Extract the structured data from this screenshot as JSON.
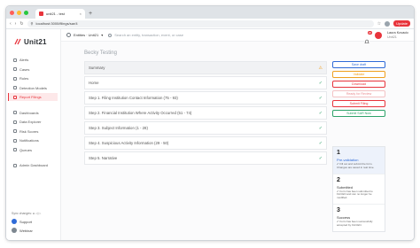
{
  "browser": {
    "tab_title": "unit21 - test",
    "tab_close": "×",
    "new_tab": "+",
    "url": "localhost:3000/filings/sar/4",
    "update_label": "Update"
  },
  "brand": {
    "logo_text": "Unit21",
    "accent": "#e8343c"
  },
  "sidebar": {
    "items": [
      {
        "label": "Alerts"
      },
      {
        "label": "Cases"
      },
      {
        "label": "Rules"
      },
      {
        "label": "Detection Models"
      },
      {
        "label": "Report Filings",
        "active": true
      }
    ],
    "items2": [
      {
        "label": "Dashboards"
      },
      {
        "label": "Data Explorer"
      },
      {
        "label": "Risk Scores"
      },
      {
        "label": "Notifications"
      },
      {
        "label": "Queues"
      }
    ],
    "items3": [
      {
        "label": "Admin Dashboard"
      }
    ],
    "footer_text": "Sync changes: ● ◁ ▷",
    "support_label": "Support",
    "webinar_label": "Webinar"
  },
  "topbar": {
    "org_label": "Entities · Unit21",
    "search_placeholder": "Search an entity, transaction, event, or case",
    "notification_count": "20",
    "user_name": "Laura Kovacic",
    "user_role": "Unit21"
  },
  "form": {
    "title": "Becky Testing",
    "steps": [
      {
        "label": "Summary",
        "status": "warn"
      },
      {
        "label": "Home",
        "status": "ok"
      },
      {
        "label": "Step 1. Filing Institution Contact Information (75 - 93)",
        "status": "ok"
      },
      {
        "label": "Step 2. Financial Institution Where Activity Occurred (51 - 74)",
        "status": "ok"
      },
      {
        "label": "Step 3. Subject Information (1 - 28)",
        "status": "ok"
      },
      {
        "label": "Step 4. Suspicious Activity Information (29 - 50)",
        "status": "ok"
      },
      {
        "label": "Step 5. Narrative",
        "status": "ok"
      }
    ]
  },
  "actions": [
    {
      "label": "Save draft",
      "color": "#2f6bd8"
    },
    {
      "label": "Validate",
      "color": "#f0a020"
    },
    {
      "label": "Download",
      "color": "#e8343c"
    },
    {
      "label": "Ready for Review",
      "color": "#e88a8e"
    },
    {
      "label": "Submit Filing",
      "color": "#e8343c"
    },
    {
      "label": "Submit SAR Now",
      "color": "#2ea36a"
    }
  ],
  "workflow": [
    {
      "num": "1",
      "title": "Pre-validation",
      "desc": "✔ Fill out and submit the form. Changes are saved in real time."
    },
    {
      "num": "2",
      "title": "Submitted",
      "desc": "✔ Form has been submitted to FinCEN and can no longer be modified."
    },
    {
      "num": "3",
      "title": "Success",
      "desc": "✔ Form has been successfully accepted by FinCEN."
    }
  ]
}
